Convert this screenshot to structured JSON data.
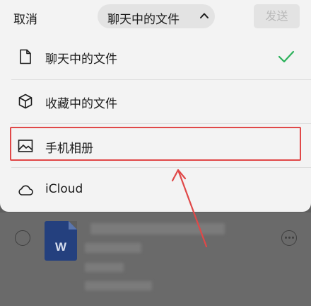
{
  "header": {
    "cancel_label": "取消",
    "title": "聊天中的文件",
    "send_label": "发送"
  },
  "menu": {
    "items": [
      {
        "label": "聊天中的文件",
        "icon": "document-icon",
        "selected": true
      },
      {
        "label": "收藏中的文件",
        "icon": "cube-icon",
        "selected": false
      },
      {
        "label": "手机相册",
        "icon": "image-icon",
        "selected": false,
        "highlighted": true
      },
      {
        "label": "iCloud",
        "icon": "cloud-icon",
        "selected": false
      }
    ]
  },
  "background_file": {
    "icon": "word-document-icon",
    "icon_letter": "W"
  },
  "colors": {
    "check": "#2bb15a",
    "highlight": "#e04848",
    "sheet_background": "#f3f3f3",
    "overlay": "#5e5e5e"
  }
}
